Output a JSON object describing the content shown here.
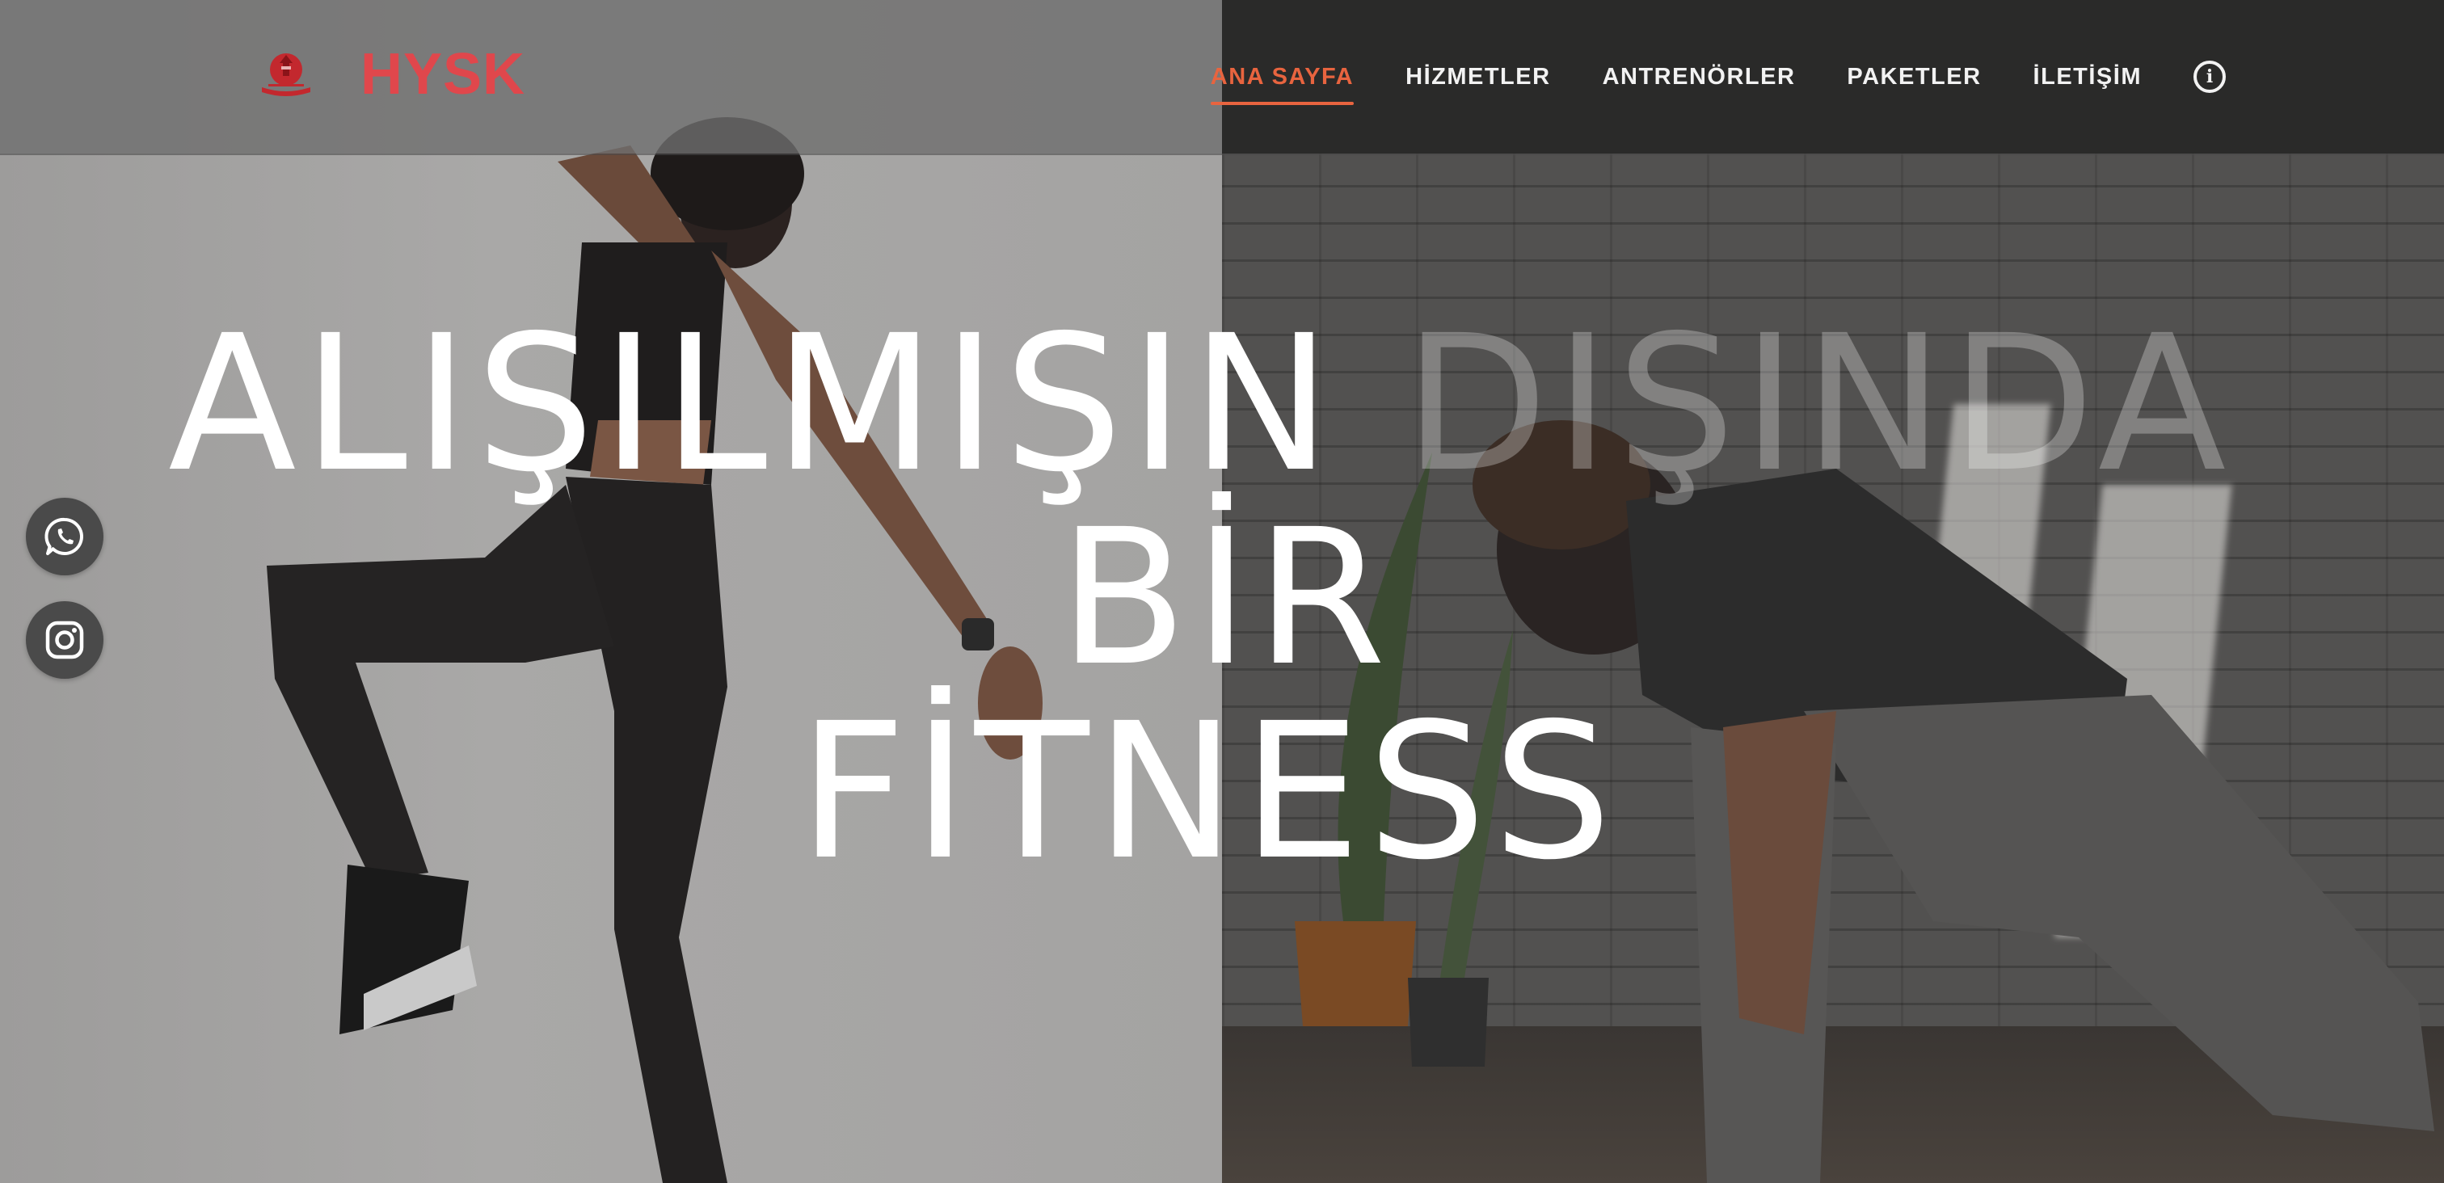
{
  "brand": {
    "name": "HYSK",
    "logo_icon": "red-emblem-logo"
  },
  "nav": {
    "items": [
      {
        "label": "ANA SAYFA",
        "active": true
      },
      {
        "label": "HİZMETLER",
        "active": false
      },
      {
        "label": "ANTRENÖRLER",
        "active": false
      },
      {
        "label": "PAKETLER",
        "active": false
      },
      {
        "label": "İLETİŞİM",
        "active": false
      }
    ],
    "info_icon": "info-circle-icon",
    "info_glyph": "i"
  },
  "hero": {
    "line1_main": "ALIŞILMIŞIN",
    "line1_faded": "DIŞINDA",
    "line2": "BİR",
    "line3": "FİTNESS"
  },
  "social": {
    "whatsapp_icon": "whatsapp-icon",
    "instagram_icon": "instagram-icon"
  },
  "colors": {
    "brand_red": "#e0474c",
    "active_nav": "#e8643f",
    "nav_text": "#f2f2f2",
    "headline": "#ffffff",
    "social_bg": "#4a4a4a"
  }
}
